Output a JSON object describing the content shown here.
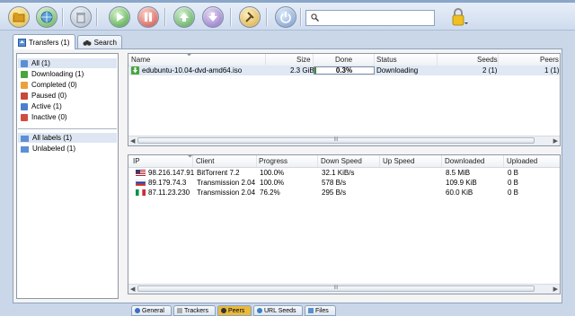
{
  "search": {
    "placeholder": ""
  },
  "tabs": [
    {
      "label": "Transfers (1)"
    },
    {
      "label": "Search"
    }
  ],
  "sidebar": {
    "status_items": [
      {
        "label": "All (1)",
        "color": "#5b8fd4"
      },
      {
        "label": "Downloading (1)",
        "color": "#4aa53c"
      },
      {
        "label": "Completed (0)",
        "color": "#e9a23b"
      },
      {
        "label": "Paused (0)",
        "color": "#c9473b"
      },
      {
        "label": "Active (1)",
        "color": "#4a7fcf"
      },
      {
        "label": "Inactive (0)",
        "color": "#d24c3f"
      }
    ],
    "label_items": [
      {
        "label": "All labels (1)"
      },
      {
        "label": "Unlabeled (1)"
      }
    ]
  },
  "torrents": {
    "columns": [
      "Name",
      "Size",
      "Done",
      "Status",
      "Seeds",
      "Peers"
    ],
    "rows": [
      {
        "name": "edubuntu-10.04-dvd-amd64.iso",
        "size": "2.3 GiB",
        "done": "0.3%",
        "done_fraction": 0.003,
        "status": "Downloading",
        "seeds": "2 (1)",
        "peers": "1 (1)"
      }
    ],
    "scroll_center": "III"
  },
  "peers": {
    "columns": [
      "IP",
      "Client",
      "Progress",
      "Down Speed",
      "Up Speed",
      "Downloaded",
      "Uploaded"
    ],
    "rows": [
      {
        "flag": "us",
        "ip": "98.216.147.91",
        "client": "BitTorrent 7.2",
        "progress": "100.0%",
        "down": "32.1 KiB/s",
        "up": "",
        "downloaded": "8.5 MiB",
        "uploaded": "0 B"
      },
      {
        "flag": "ru",
        "ip": "89.179.74.3",
        "client": "Transmission 2.04",
        "progress": "100.0%",
        "down": "578 B/s",
        "up": "",
        "downloaded": "109.9 KiB",
        "uploaded": "0 B"
      },
      {
        "flag": "it",
        "ip": "87.11.23.230",
        "client": "Transmission 2.04",
        "progress": "76.2%",
        "down": "295 B/s",
        "up": "",
        "downloaded": "60.0 KiB",
        "uploaded": "0 B"
      }
    ],
    "scroll_center": "III"
  },
  "bottom_tabs": [
    {
      "label": "General"
    },
    {
      "label": "Trackers"
    },
    {
      "label": "Peers"
    },
    {
      "label": "URL Seeds"
    },
    {
      "label": "Files"
    }
  ]
}
